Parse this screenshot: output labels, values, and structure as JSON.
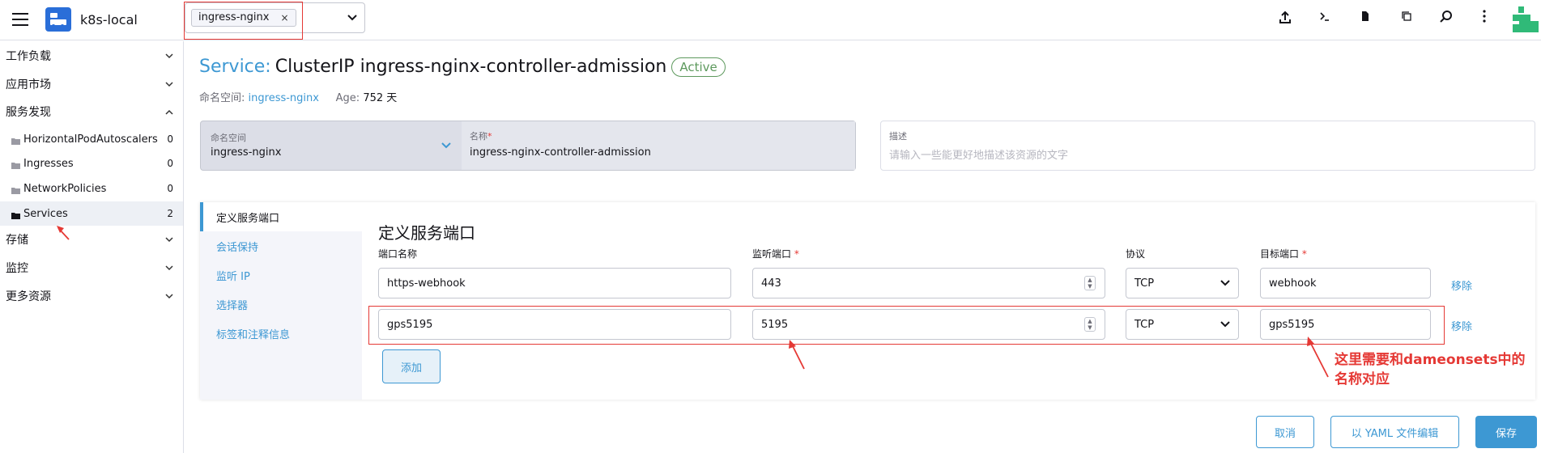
{
  "header": {
    "cluster_name": "k8s-local",
    "namespace_chip": "ingress-nginx",
    "chip_remove": "×",
    "icons": [
      "upload-icon",
      "terminal-icon",
      "file-icon",
      "copy-icon",
      "search-icon",
      "more-vertical-icon"
    ]
  },
  "sidebar": {
    "groups": [
      {
        "label": "工作负载",
        "state": "collapsed"
      },
      {
        "label": "应用市场",
        "state": "collapsed"
      },
      {
        "label": "服务发现",
        "state": "expanded"
      },
      {
        "label": "存储",
        "state": "collapsed"
      },
      {
        "label": "监控",
        "state": "collapsed"
      },
      {
        "label": "更多资源",
        "state": "collapsed"
      }
    ],
    "items": [
      {
        "label": "HorizontalPodAutoscalers",
        "count": "0"
      },
      {
        "label": "Ingresses",
        "count": "0"
      },
      {
        "label": "NetworkPolicies",
        "count": "0"
      },
      {
        "label": "Services",
        "count": "2",
        "active": true
      }
    ]
  },
  "page": {
    "kind": "Service:",
    "title": "ClusterIP ingress-nginx-controller-admission",
    "status": "Active",
    "ns_label": "命名空间:",
    "ns_value": "ingress-nginx",
    "age_label": "Age:",
    "age_value": "752 天"
  },
  "form": {
    "namespace_label": "命名空间",
    "namespace_value": "ingress-nginx",
    "name_label": "名称",
    "name_required": "*",
    "name_value": "ingress-nginx-controller-admission",
    "desc_label": "描述",
    "desc_placeholder": "请输入一些能更好地描述该资源的文字"
  },
  "tabs": [
    {
      "label": "定义服务端口",
      "active": true
    },
    {
      "label": "会话保持"
    },
    {
      "label": "监听 IP"
    },
    {
      "label": "选择器"
    },
    {
      "label": "标签和注释信息"
    }
  ],
  "ports": {
    "section_title": "定义服务端口",
    "headers": {
      "name": "端口名称",
      "listen": "监听端口",
      "protocol": "协议",
      "target": "目标端口",
      "required": "*"
    },
    "rows": [
      {
        "name": "https-webhook",
        "port": "443",
        "protocol": "TCP",
        "target": "webhook",
        "remove": "移除"
      },
      {
        "name": "gps5195",
        "port": "5195",
        "protocol": "TCP",
        "target": "gps5195",
        "remove": "移除"
      }
    ],
    "add_label": "添加"
  },
  "footer": {
    "cancel": "取消",
    "yaml": "以 YAML 文件编辑",
    "save": "保存"
  },
  "annotation": {
    "line1": "这里需要和dameonsets中的",
    "line2": "名称对应"
  },
  "colors": {
    "accent": "#3d98d3",
    "active_badge": "#5d995d",
    "annotation": "#e53935",
    "brand": "#30ba78"
  }
}
